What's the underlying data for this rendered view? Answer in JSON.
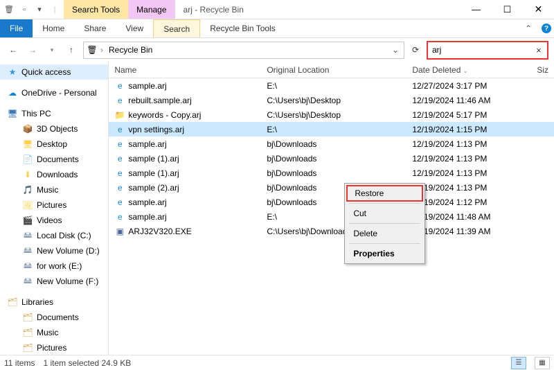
{
  "titlebar": {
    "context_tabs": {
      "search": "Search Tools",
      "manage": "Manage"
    },
    "title": "arj - Recycle Bin",
    "win": {
      "min": "—",
      "max": "☐",
      "close": "✕"
    }
  },
  "ribbon": {
    "file": "File",
    "home": "Home",
    "share": "Share",
    "view": "View",
    "search": "Search",
    "rtools": "Recycle Bin Tools"
  },
  "address": {
    "location": "Recycle Bin",
    "search_query": "arj"
  },
  "sidebar": {
    "quick_access": "Quick access",
    "onedrive": "OneDrive - Personal",
    "this_pc": "This PC",
    "pc_items": [
      {
        "label": "3D Objects",
        "icon": "cube"
      },
      {
        "label": "Desktop",
        "icon": "desktop"
      },
      {
        "label": "Documents",
        "icon": "doc"
      },
      {
        "label": "Downloads",
        "icon": "down"
      },
      {
        "label": "Music",
        "icon": "music"
      },
      {
        "label": "Pictures",
        "icon": "pic"
      },
      {
        "label": "Videos",
        "icon": "vid"
      },
      {
        "label": "Local Disk (C:)",
        "icon": "drive"
      },
      {
        "label": "New Volume (D:)",
        "icon": "drive"
      },
      {
        "label": "for work (E:)",
        "icon": "drive"
      },
      {
        "label": "New Volume (F:)",
        "icon": "drive"
      }
    ],
    "libraries": "Libraries",
    "lib_items": [
      {
        "label": "Documents"
      },
      {
        "label": "Music"
      },
      {
        "label": "Pictures"
      }
    ]
  },
  "columns": {
    "name": "Name",
    "ol": "Original Location",
    "date": "Date Deleted",
    "size": "Siz"
  },
  "rows": [
    {
      "icon": "ie",
      "name": "sample.arj",
      "ol": "E:\\",
      "date": "12/27/2024 3:17 PM",
      "sel": false
    },
    {
      "icon": "ie",
      "name": "rebuilt.sample.arj",
      "ol": "C:\\Users\\bj\\Desktop",
      "date": "12/19/2024 11:46 AM",
      "sel": false
    },
    {
      "icon": "folder",
      "name": "keywords - Copy.arj",
      "ol": "C:\\Users\\bj\\Desktop",
      "date": "12/19/2024 5:17 PM",
      "sel": false
    },
    {
      "icon": "ie",
      "name": "vpn settings.arj",
      "ol": "E:\\",
      "date": "12/19/2024 1:15 PM",
      "sel": true
    },
    {
      "icon": "ie",
      "name": "sample.arj",
      "ol": "                  bj\\Downloads",
      "date": "12/19/2024 1:13 PM",
      "sel": false
    },
    {
      "icon": "ie",
      "name": "sample (1).arj",
      "ol": "                  bj\\Downloads",
      "date": "12/19/2024 1:13 PM",
      "sel": false
    },
    {
      "icon": "ie",
      "name": "sample (1).arj",
      "ol": "                  bj\\Downloads",
      "date": "12/19/2024 1:13 PM",
      "sel": false
    },
    {
      "icon": "ie",
      "name": "sample (2).arj",
      "ol": "                  bj\\Downloads",
      "date": "12/19/2024 1:13 PM",
      "sel": false
    },
    {
      "icon": "ie",
      "name": "sample.arj",
      "ol": "                  bj\\Downloads",
      "date": "12/19/2024 1:12 PM",
      "sel": false
    },
    {
      "icon": "ie",
      "name": "sample.arj",
      "ol": "E:\\",
      "date": "12/19/2024 11:48 AM",
      "sel": false
    },
    {
      "icon": "exe",
      "name": "ARJ32V320.EXE",
      "ol": "C:\\Users\\bj\\Downloads",
      "date": "12/19/2024 11:39 AM",
      "sel": false
    }
  ],
  "context_menu": {
    "restore": "Restore",
    "cut": "Cut",
    "delete": "Delete",
    "properties": "Properties"
  },
  "status": {
    "items": "11 items",
    "selected": "1 item selected  24.9 KB"
  }
}
